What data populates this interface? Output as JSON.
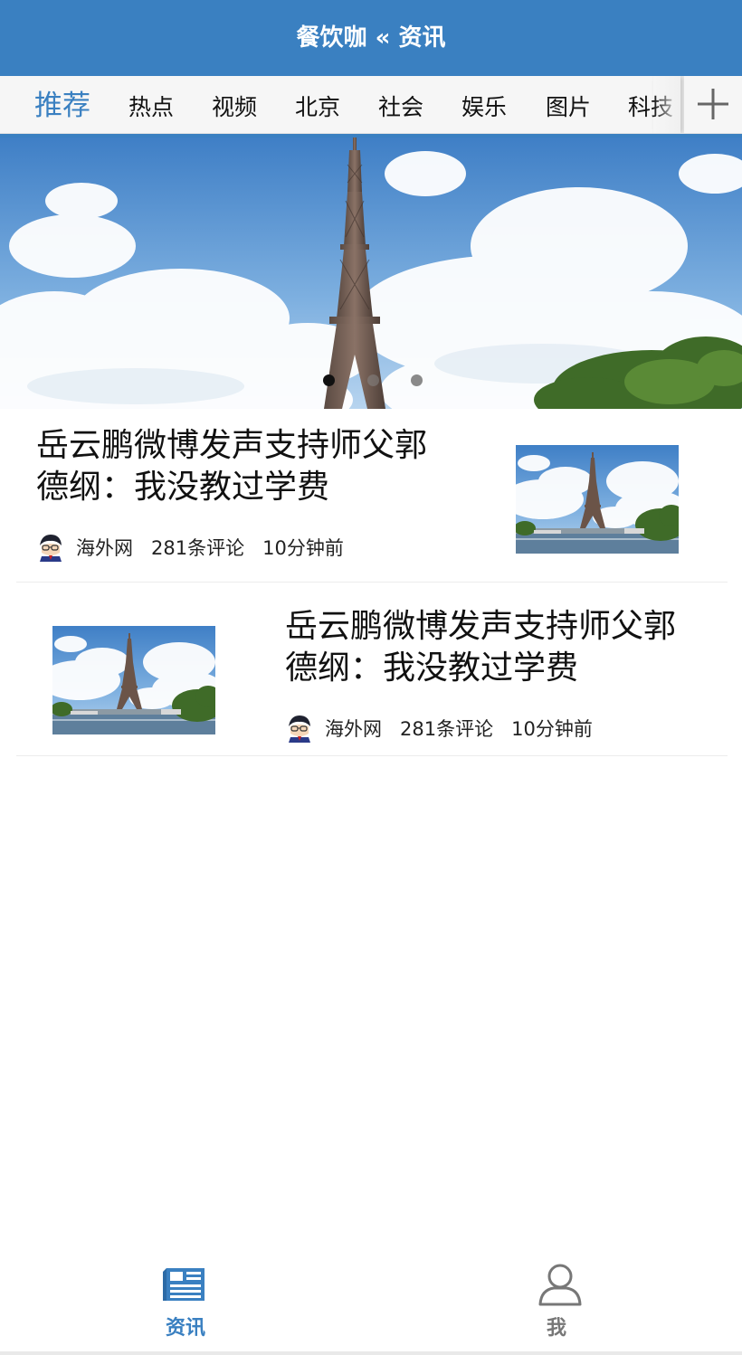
{
  "header": {
    "title": "餐饮咖 « 资讯"
  },
  "tabs": {
    "items": [
      {
        "label": "推荐",
        "active": true
      },
      {
        "label": "热点"
      },
      {
        "label": "视频"
      },
      {
        "label": "北京"
      },
      {
        "label": "社会"
      },
      {
        "label": "娱乐"
      },
      {
        "label": "图片"
      },
      {
        "label": "科技"
      }
    ],
    "add_icon": "plus-icon"
  },
  "banner": {
    "image": "eiffel-tower-photo",
    "active_slide": 1,
    "slide_count": 3
  },
  "news": [
    {
      "headline_line1": "岳云鹏微博发声支持师父郭",
      "headline_line2": "德纲：我没教过学费",
      "source": "海外网",
      "comments": "281条评论",
      "time": "10分钟前",
      "thumb": "eiffel-tower-photo",
      "layout": "text-left"
    },
    {
      "headline_line1": "岳云鹏微博发声支持师父郭",
      "headline_line2": "德纲：我没教过学费",
      "source": "海外网",
      "comments": "281条评论",
      "time": "10分钟前",
      "thumb": "eiffel-tower-photo",
      "layout": "text-right"
    }
  ],
  "bottom_nav": [
    {
      "label": "资讯",
      "icon": "news-icon",
      "active": true
    },
    {
      "label": "我",
      "icon": "user-icon",
      "active": false
    }
  ],
  "colors": {
    "accent": "#3a80c1",
    "inactive_nav": "#777777",
    "tab_bar_bg": "#f6f6f6"
  }
}
